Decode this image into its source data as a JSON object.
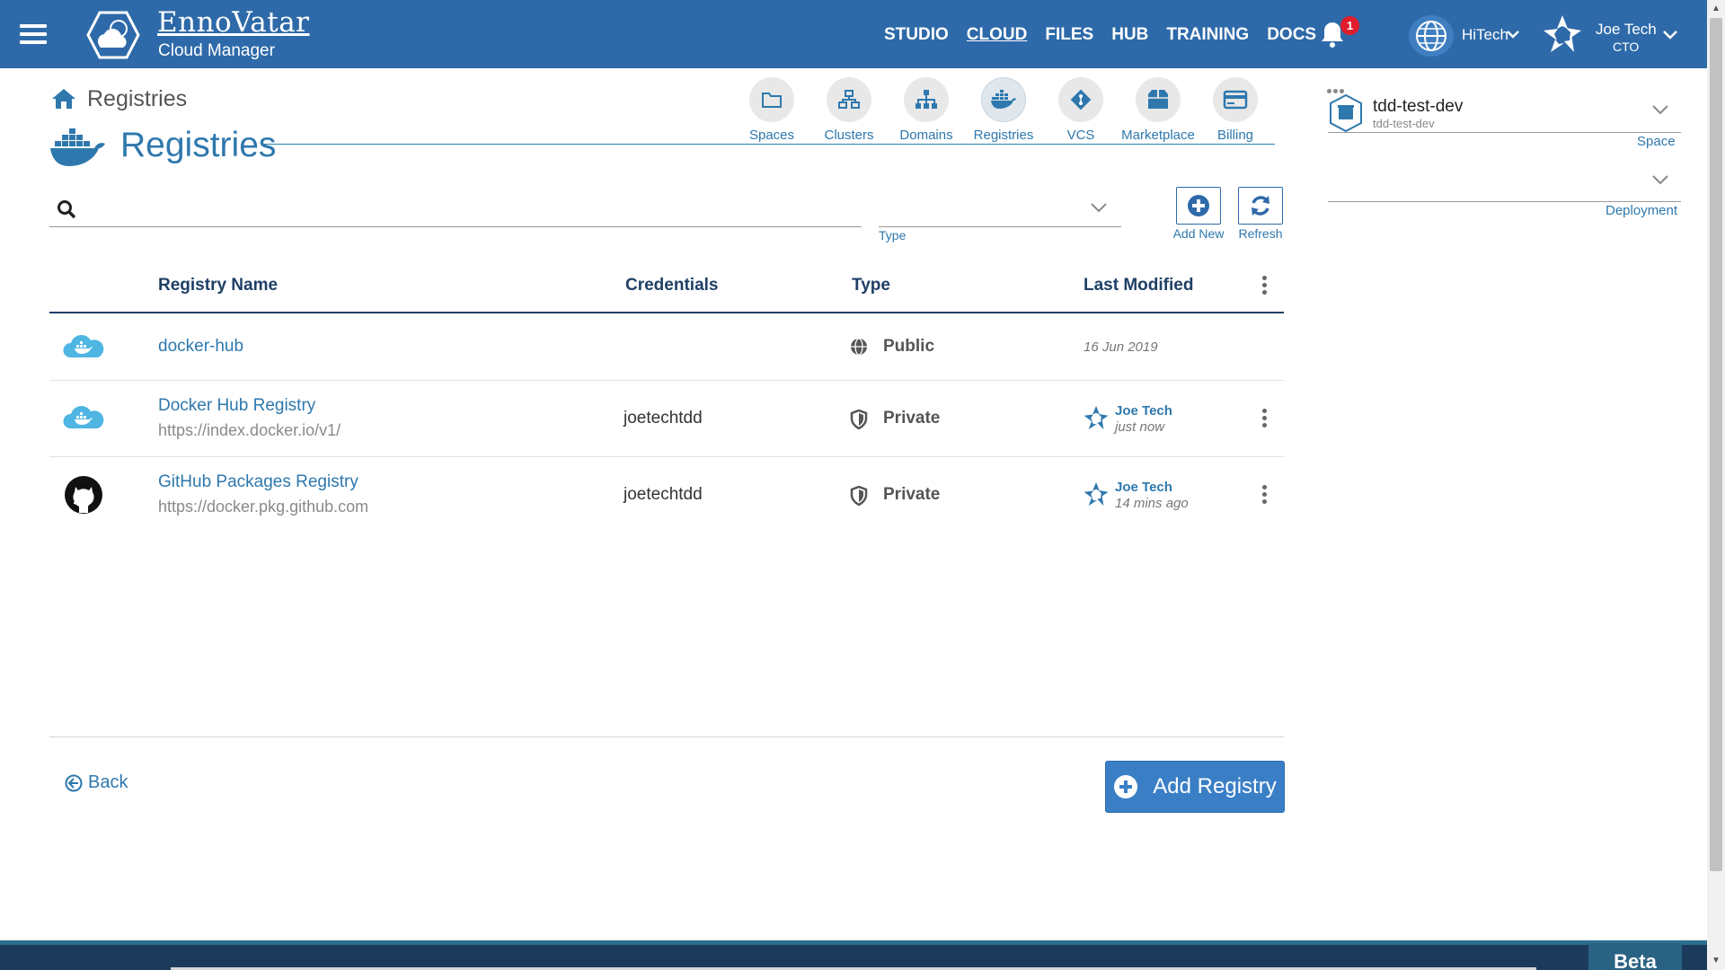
{
  "header": {
    "brand_name": "EnnoVatar",
    "brand_sub": "Cloud Manager",
    "nav": [
      "STUDIO",
      "CLOUD",
      "FILES",
      "HUB",
      "TRAINING",
      "DOCS"
    ],
    "active_nav": "CLOUD",
    "notification_count": "1",
    "org_name": "HiTech",
    "user_name": "Joe Tech",
    "user_role": "CTO"
  },
  "breadcrumb": {
    "label": "Registries"
  },
  "page": {
    "title": "Registries"
  },
  "modules": [
    {
      "label": "Spaces",
      "icon": "folder-icon"
    },
    {
      "label": "Clusters",
      "icon": "clusters-icon"
    },
    {
      "label": "Domains",
      "icon": "sitemap-icon"
    },
    {
      "label": "Registries",
      "icon": "docker-icon"
    },
    {
      "label": "VCS",
      "icon": "git-icon"
    },
    {
      "label": "Marketplace",
      "icon": "box-icon"
    },
    {
      "label": "Billing",
      "icon": "card-icon"
    }
  ],
  "search": {
    "value": "",
    "placeholder": ""
  },
  "filter": {
    "type_label": "Type",
    "type_value": ""
  },
  "actions": {
    "add_new": "Add New",
    "refresh": "Refresh"
  },
  "table": {
    "headers": {
      "name": "Registry Name",
      "credentials": "Credentials",
      "type": "Type",
      "last_modified": "Last Modified"
    },
    "rows": [
      {
        "icon": "docker-cloud-icon",
        "name": "docker-hub",
        "url": "",
        "credentials": "",
        "type": "Public",
        "type_icon": "globe-icon",
        "modified_date": "16 Jun 2019",
        "modified_by": "",
        "modified_time": ""
      },
      {
        "icon": "docker-cloud-icon",
        "name": "Docker Hub Registry",
        "url": "https://index.docker.io/v1/",
        "credentials": "joetechtdd",
        "type": "Private",
        "type_icon": "shield-icon",
        "modified_date": "",
        "modified_by": "Joe Tech",
        "modified_time": "just now"
      },
      {
        "icon": "github-icon",
        "name": "GitHub Packages Registry",
        "url": "https://docker.pkg.github.com",
        "credentials": "joetechtdd",
        "type": "Private",
        "type_icon": "shield-icon",
        "modified_date": "",
        "modified_by": "Joe Tech",
        "modified_time": "14 mins ago"
      }
    ]
  },
  "footer": {
    "back": "Back",
    "add_registry": "Add Registry"
  },
  "right_panel": {
    "space_name": "tdd-test-dev",
    "space_sub": "tdd-test-dev",
    "space_label": "Space",
    "deployment_label": "Deployment"
  },
  "bottom": {
    "beta": "Beta"
  },
  "colors": {
    "header": "#2e6aa9",
    "accent": "#2e78ad",
    "table_header": "#1f3f66",
    "button": "#3a7fc6",
    "badge": "#e01d2a"
  }
}
